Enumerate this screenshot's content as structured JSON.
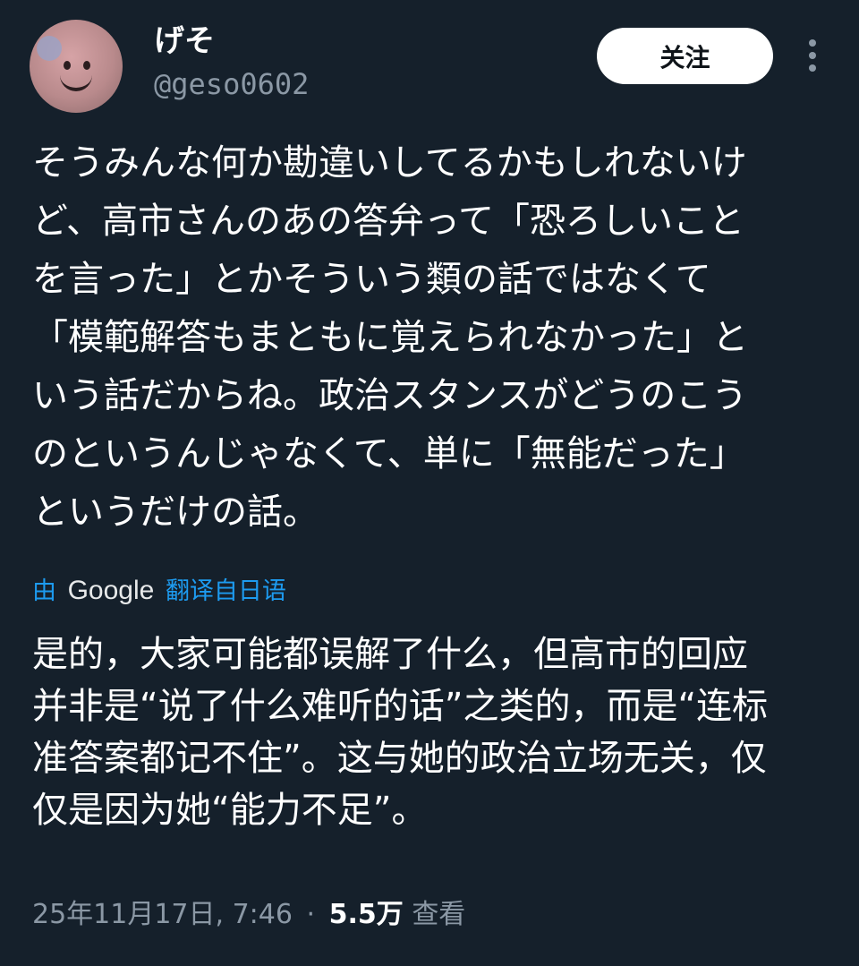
{
  "user": {
    "display_name": "げそ",
    "handle": "@geso0602"
  },
  "follow_button_label": "关注",
  "more_icon": "more-vertical-icon",
  "tweet": {
    "lines": [
      "そうみんな何か勘違いしてるかもしれないけ",
      "ど、高市さんのあの答弁って「恐ろしいこと",
      "を言った」とかそういう類の話ではなくて",
      "「模範解答もまともに覚えられなかった」と",
      "いう話だからね。政治スタンスがどうのこう",
      "のというんじゃなくて、単に「無能だった」",
      "というだけの話。"
    ]
  },
  "translation": {
    "prefix": "由",
    "provider": "Google",
    "suffix": "翻译自日语",
    "lines": [
      "是的，大家可能都误解了什么，但高市的回应",
      "并非是“说了什么难听的话”之类的，而是“连标",
      "准答案都记不住”。这与她的政治立场无关，仅",
      "仅是因为她“能力不足”。"
    ]
  },
  "meta": {
    "timestamp": "25年11月17日, 7:46",
    "separator": "·",
    "views_count": "5.5万",
    "views_label": "查看"
  },
  "colors": {
    "background": "#15202b",
    "text": "#ffffff",
    "muted": "#8b98a5",
    "link": "#1d9bf0"
  }
}
